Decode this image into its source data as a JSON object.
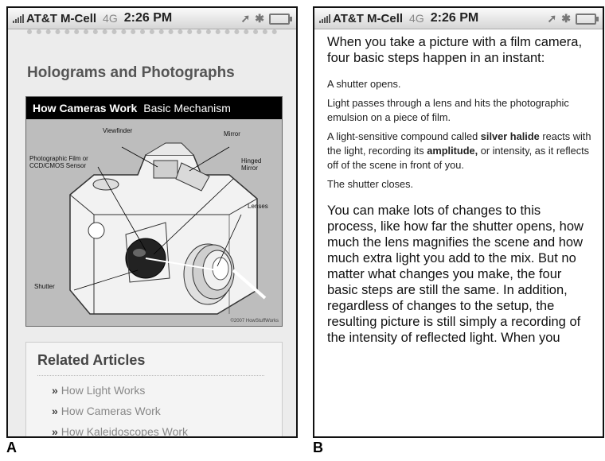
{
  "status_bar": {
    "carrier": "AT&T M-Cell",
    "network": "4G",
    "time": "2:26 PM"
  },
  "panel_a": {
    "section_title": "Holograms and Photographs",
    "figure": {
      "header_bold": "How Cameras Work",
      "header_sub": "Basic Mechanism",
      "labels": {
        "viewfinder": "Viewfinder",
        "mirror": "Mirror",
        "film_line1": "Photographic Film or",
        "film_line2": "CCD/CMOS Sensor",
        "hinged_line1": "Hinged",
        "hinged_line2": "Mirror",
        "lenses": "Lenses",
        "shutter": "Shutter"
      },
      "copyright": "©2007 HowStuffWorks"
    },
    "related": {
      "title": "Related Articles",
      "items": [
        "How Light Works",
        "How Cameras Work",
        "How Kaleidoscopes Work"
      ]
    }
  },
  "panel_b": {
    "intro": "When you take a picture with a film camera, four basic steps happen in an instant:",
    "step1": "A shutter opens.",
    "step2": "Light passes through a lens and hits the photographic emulsion on a piece of film.",
    "step3": {
      "pre": "A light-sensitive compound called ",
      "bold1": "silver halide",
      "mid": " reacts with the light, recording its ",
      "bold2": "amplitude,",
      "post": " or intensity, as it reflects off of the scene in front of you."
    },
    "step4": "The shutter closes.",
    "outro": "You can make lots of changes to this process, like how far the shutter opens, how much the lens magnifies the scene and how much extra light you add to the mix. But no matter what changes you make, the four basic steps are still the same. In addition, regardless of changes to the setup, the resulting picture is still simply a recording of the intensity of reflected light. When you"
  },
  "panel_labels": {
    "a": "A",
    "b": "B"
  }
}
